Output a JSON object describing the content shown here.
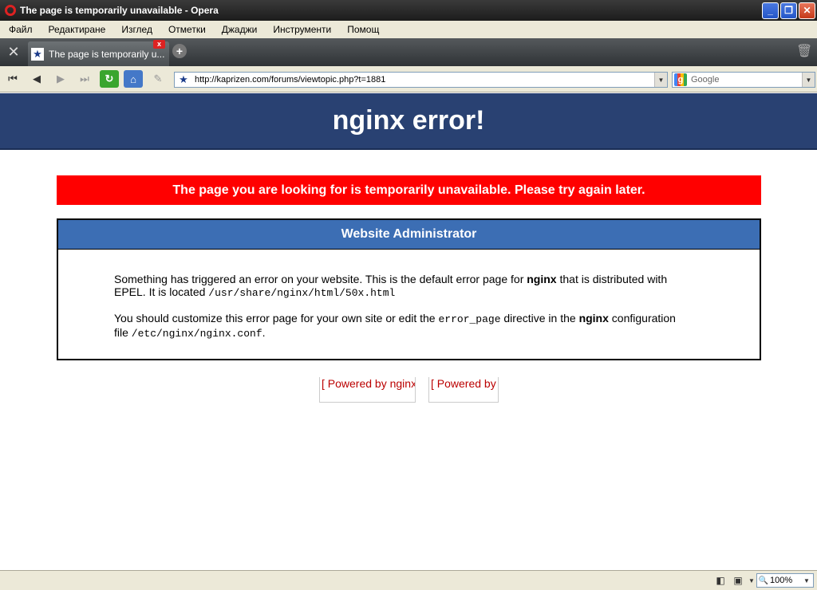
{
  "window": {
    "title": "The page is temporarily unavailable - Opera",
    "minimize": "_",
    "maximize": "❐",
    "close": "✕"
  },
  "menu": [
    "Файл",
    "Редактиране",
    "Изглед",
    "Отметки",
    "Джаджи",
    "Инструменти",
    "Помощ"
  ],
  "tabs": [
    {
      "label": "The page is temporarily u...",
      "close": "x"
    }
  ],
  "address": {
    "url": "http://kaprizen.com/forums/viewtopic.php?t=1881",
    "search_engine": "Google"
  },
  "page": {
    "banner": "nginx error!",
    "alert": "The page you are looking for is temporarily unavailable. Please try again later.",
    "admin_title": "Website Administrator",
    "p1_a": "Something has triggered an error on your website. This is the default error page for ",
    "p1_b": "nginx",
    "p1_c": " that is distributed with EPEL. It is located ",
    "p1_path": "/usr/share/nginx/html/50x.html",
    "p2_a": "You should customize this error page for your own site or edit the ",
    "p2_code": "error_page",
    "p2_b": " directive in the ",
    "p2_nginx": "nginx",
    "p2_c": " configuration file ",
    "p2_path": "/etc/nginx/nginx.conf",
    "p2_end": ".",
    "powered1": "[ Powered by nginx",
    "powered2": "[ Powered by"
  },
  "status": {
    "zoom": "100%"
  },
  "colors": {
    "banner_bg": "#294172",
    "alert_bg": "#ff0000",
    "admin_header_bg": "#3c6eb4"
  }
}
